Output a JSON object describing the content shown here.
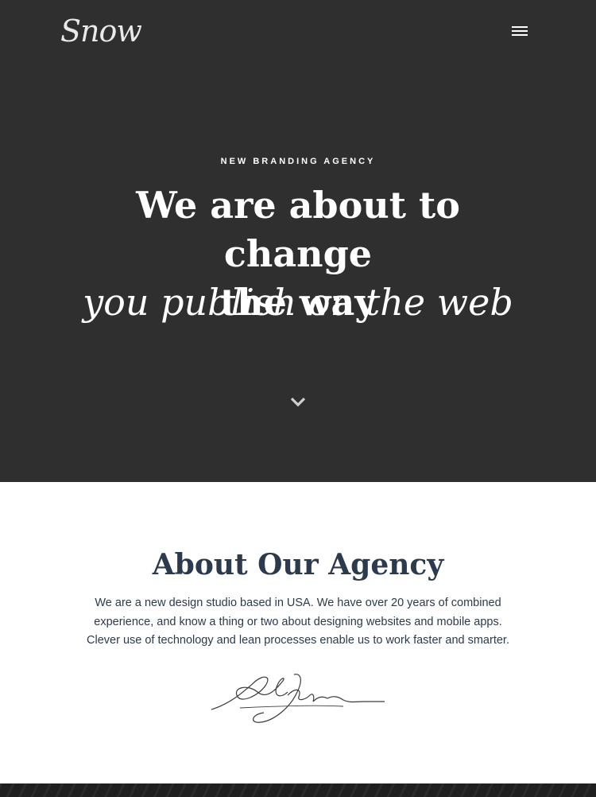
{
  "header": {
    "logo_text": "Snow",
    "menu_icon": "hamburger-menu-icon"
  },
  "hero": {
    "eyebrow": "NEW BRANDING AGENCY",
    "headline_line1": "We are about to change",
    "headline_line2": "the way",
    "headline_italic": "you publish on the web",
    "scroll_icon": "chevron-down-icon"
  },
  "about": {
    "title": "About Our Agency",
    "text_line1": "We are a new design studio based in USA. We have over 20 years of combined",
    "text_line2": "experience, and know a thing or two about designing websites and mobile apps.",
    "text_line3": "Clever use of technology and lean processes enable us to work faster and smarter.",
    "signature_text": "G. L. Jordan"
  },
  "colors": {
    "hero_bg": "#2f2f30",
    "heading_text": "#2b3a4c",
    "body_text": "#2b3a4c",
    "white": "#ffffff"
  }
}
